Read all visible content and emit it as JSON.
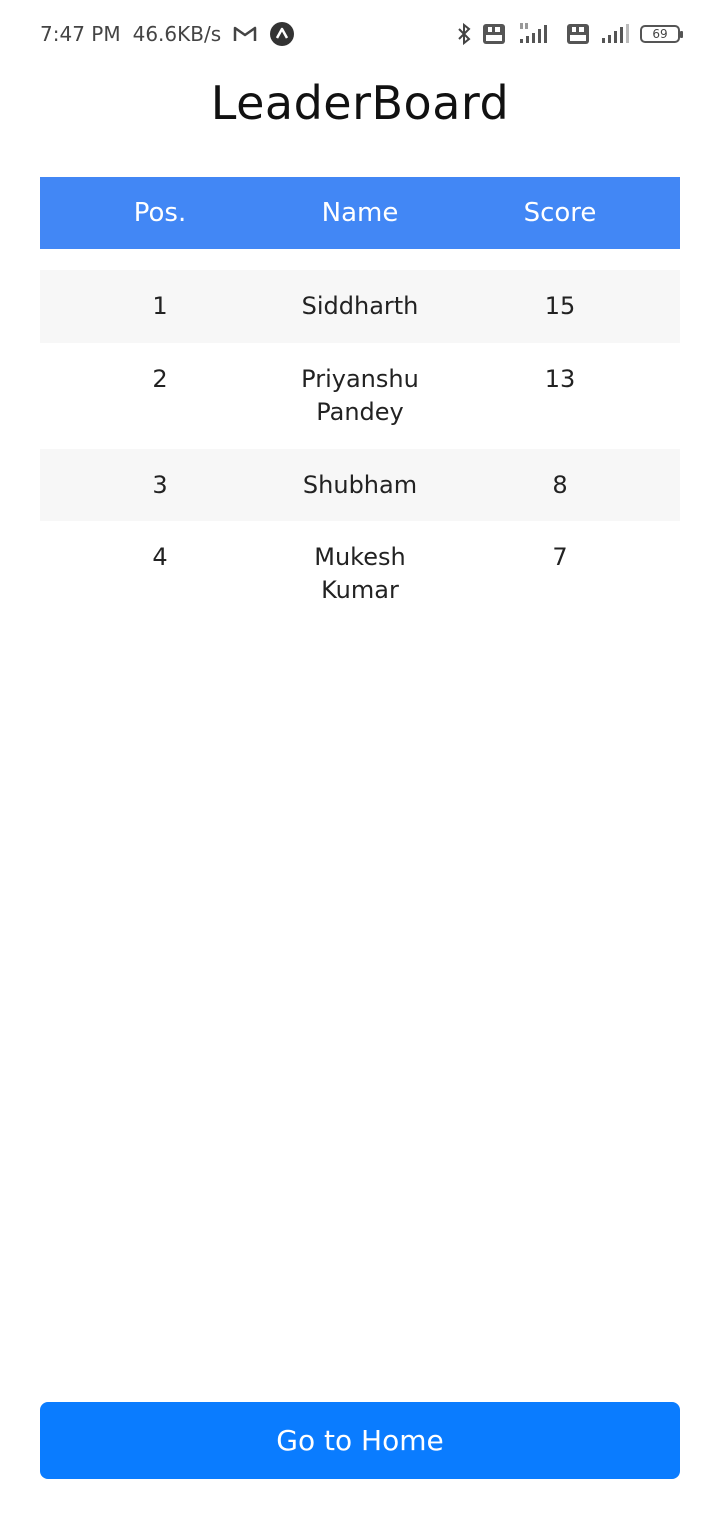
{
  "status_bar": {
    "time": "7:47 PM",
    "network_speed": "46.6KB/s",
    "battery_level": "69",
    "icons": [
      "gmail-icon",
      "app-notification-icon",
      "bluetooth-icon",
      "volte-icon",
      "signal-4g-icon",
      "volte-icon",
      "signal-icon",
      "battery-icon"
    ]
  },
  "title": "LeaderBoard",
  "table": {
    "headers": {
      "position": "Pos.",
      "name": "Name",
      "score": "Score"
    },
    "rows": [
      {
        "position": "1",
        "name": "Siddharth",
        "score": "15"
      },
      {
        "position": "2",
        "name": "Priyanshu Pandey",
        "score": "13"
      },
      {
        "position": "3",
        "name": "Shubham",
        "score": "8"
      },
      {
        "position": "4",
        "name": "Mukesh Kumar",
        "score": "7"
      }
    ]
  },
  "home_button": {
    "label": "Go to Home"
  },
  "colors": {
    "header_bg": "#4287f5",
    "button_bg": "#0a7cff",
    "row_shade": "#f7f7f7"
  }
}
